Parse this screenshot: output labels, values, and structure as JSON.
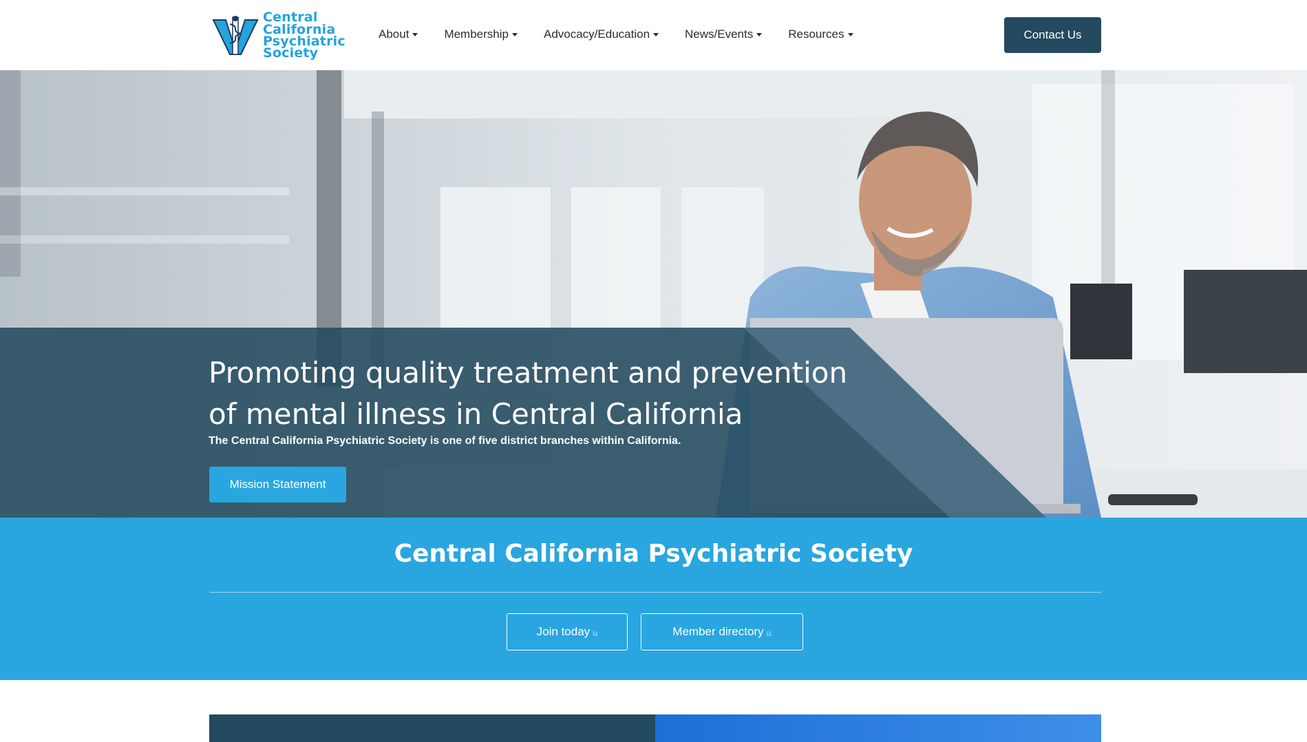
{
  "brand": {
    "logo_lines": [
      "Central",
      "California",
      "Psychiatric",
      "Society"
    ],
    "logo_color": "#24a3dc"
  },
  "nav": {
    "items": [
      {
        "label": "About"
      },
      {
        "label": "Membership"
      },
      {
        "label": "Advocacy/Education"
      },
      {
        "label": "News/Events"
      },
      {
        "label": "Resources"
      }
    ],
    "contact_label": "Contact Us"
  },
  "hero": {
    "title_line1": "Promoting quality treatment and prevention",
    "title_line2": "of mental illness in Central California",
    "subtitle": "The Central California Psychiatric Society is one of five district branches within California.",
    "button_label": "Mission Statement"
  },
  "band": {
    "title": "Central California Psychiatric Society",
    "join_label": "Join today",
    "directory_label": "Member directory"
  },
  "colors": {
    "dark_navy": "#234a5f",
    "accent_blue": "#29a6e0",
    "bright_blue": "#1e6fd6"
  }
}
